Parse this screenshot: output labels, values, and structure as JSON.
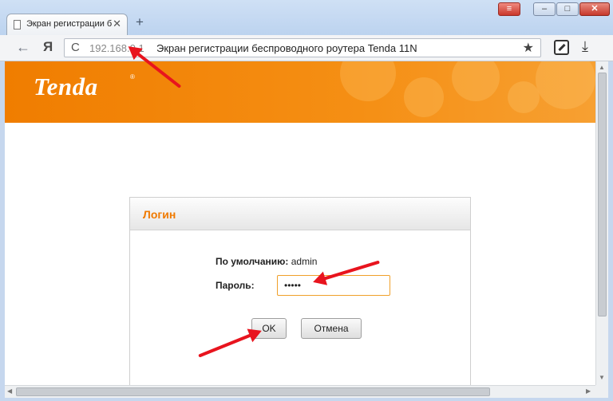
{
  "browser": {
    "tab_title": "Экран регистрации б",
    "tab_close": "✕",
    "new_tab": "+",
    "back": "←",
    "yandex": "Я",
    "reload": "C",
    "url_host": "192.168.0.1",
    "url_title": "Экран регистрации беспроводного роутера Tenda 11N",
    "star": "★",
    "download": "⤓",
    "window_controls": {
      "menu": "≡",
      "minimize": "–",
      "maximize": "□",
      "close": "✕"
    }
  },
  "header": {
    "logo": "Tenda",
    "logo_mark": "®",
    "color": "#f58a0e"
  },
  "dialog": {
    "title": "Логин",
    "default_label": "По умолчанию:",
    "default_value": "admin",
    "password_label": "Пароль:",
    "password_value": "•••••",
    "ok_label": "OK",
    "cancel_label": "Отмена",
    "title_color": "#f07a00"
  },
  "annotation_color": "#e8141e"
}
